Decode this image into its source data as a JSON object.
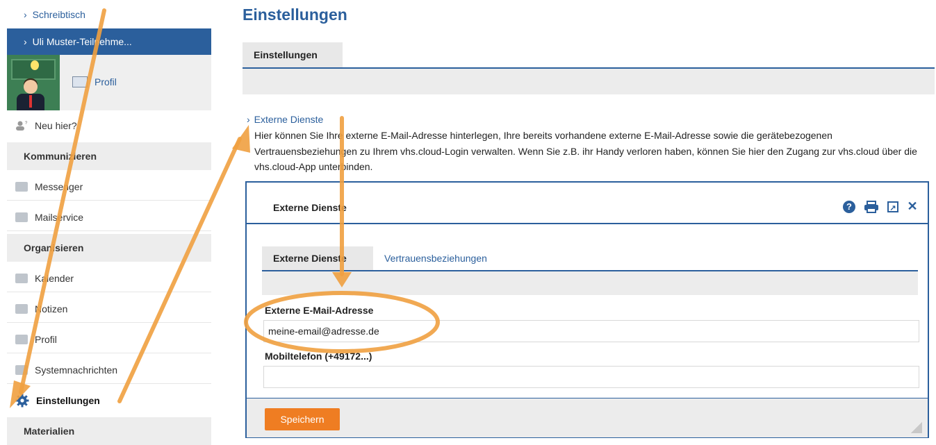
{
  "sidebar": {
    "links": [
      {
        "label": "Schreibtisch"
      }
    ],
    "active_user": "Uli Muster-Teilnehme...",
    "profile_link": "Profil",
    "new_here": "Neu hier?",
    "sections": {
      "communicate": "Kommunizieren",
      "organize": "Organisieren",
      "materials": "Materialien"
    },
    "items": {
      "messenger": "Messenger",
      "mailservice": "Mailservice",
      "calendar": "Kalender",
      "notes": "Notizen",
      "profile": "Profil",
      "system_messages": "Systemnachrichten",
      "settings": "Einstellungen"
    }
  },
  "main": {
    "title": "Einstellungen",
    "tab": "Einstellungen",
    "external_services_link": "Externe Dienste",
    "description": "Hier können Sie Ihre externe E-Mail-Adresse hinterlegen, Ihre bereits vorhandene externe E-Mail-Adresse sowie die gerätebezogenen Vertrauensbeziehungen zu Ihrem vhs.cloud-Login verwalten. Wenn Sie z.B. ihr Handy verloren haben, können Sie hier den Zugang zur vhs.cloud über die vhs.cloud-App unterbinden."
  },
  "dialog": {
    "title": "Externe Dienste",
    "tabs": [
      "Externe Dienste",
      "Vertrauensbeziehungen"
    ],
    "email_label": "Externe E-Mail-Adresse",
    "email_value": "meine-email@adresse.de",
    "mobile_label": "Mobiltelefon (+49172...)",
    "mobile_value": "",
    "save_label": "Speichern"
  },
  "colors": {
    "brand_blue": "#2b5f9c",
    "save_orange": "#ef7d22",
    "annotation_orange": "#f0a040"
  },
  "icons": [
    "chevron-right-icon",
    "avatar-image",
    "profile-card-icon",
    "user-plus-icon",
    "messenger-icon",
    "mail-icon",
    "calendar-icon",
    "notes-icon",
    "profile-icon",
    "system-message-icon",
    "gear-icon",
    "help-icon",
    "print-icon",
    "popout-icon",
    "close-icon"
  ]
}
